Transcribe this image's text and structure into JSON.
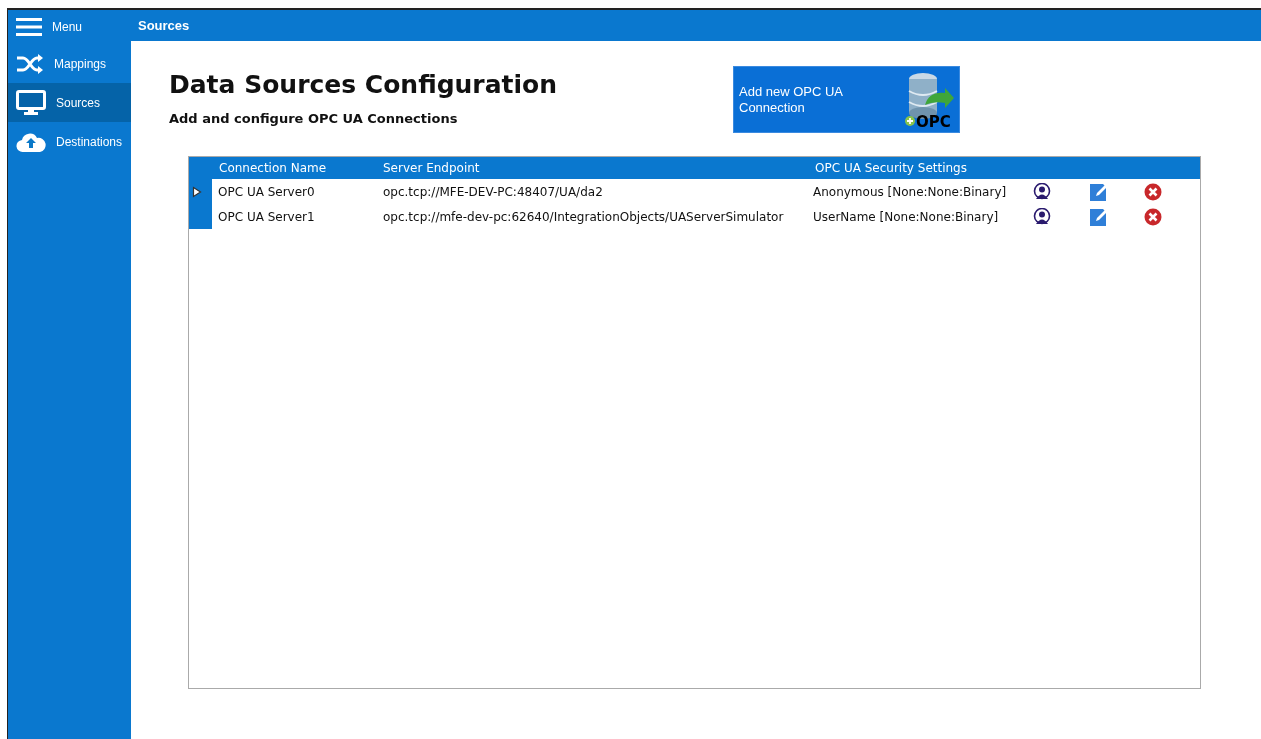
{
  "sidebar": {
    "items": [
      {
        "kind": "menu",
        "label": "Menu",
        "selected": false
      },
      {
        "kind": "shuffle",
        "label": "Mappings",
        "selected": false
      },
      {
        "kind": "monitor",
        "label": "Sources",
        "selected": true
      },
      {
        "kind": "cloud",
        "label": "Destinations",
        "selected": false
      }
    ]
  },
  "header": {
    "title": "Sources"
  },
  "page": {
    "title": "Data Sources Configuration",
    "subtitle": "Add and configure OPC UA Connections"
  },
  "add_button": {
    "label": "Add new OPC UA Connection",
    "icon_text": "OPC"
  },
  "table": {
    "columns": [
      "Connection Name",
      "Server Endpoint",
      "OPC UA Security Settings"
    ],
    "rows": [
      {
        "name": "OPC UA Server0",
        "endpoint": "opc.tcp://MFE-DEV-PC:48407/UA/da2",
        "security": "Anonymous [None:None:Binary]",
        "selected": true
      },
      {
        "name": "OPC UA Server1",
        "endpoint": "opc.tcp://mfe-dev-pc:62640/IntegrationObjects/UAServerSimulator",
        "security": "UserName [None:None:Binary]",
        "selected": false
      }
    ]
  }
}
